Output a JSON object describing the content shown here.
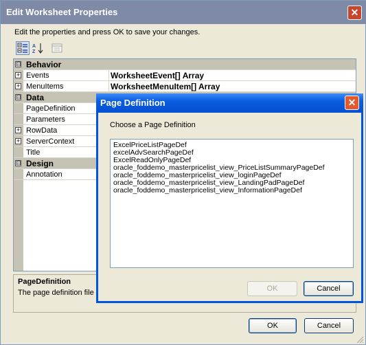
{
  "window": {
    "title": "Edit Worksheet Properties",
    "close_glyph": "✕"
  },
  "instructions": "Edit the properties and press OK to save your changes.",
  "toolbar": {
    "buttons": [
      "categorized-icon",
      "alphabetical-icon",
      "property-pages-icon"
    ]
  },
  "property_grid": {
    "rows": [
      {
        "kind": "category",
        "expander": "⊟",
        "name": "Behavior",
        "value": ""
      },
      {
        "kind": "property",
        "expander": "+",
        "name": "Events",
        "value": "WorksheetEvent[] Array"
      },
      {
        "kind": "property",
        "expander": "+",
        "name": "MenuItems",
        "value": "WorksheetMenuItem[] Array"
      },
      {
        "kind": "category",
        "expander": "⊟",
        "name": "Data",
        "value": ""
      },
      {
        "kind": "property",
        "expander": "",
        "name": "PageDefinition",
        "value": ""
      },
      {
        "kind": "property",
        "expander": "",
        "name": "Parameters",
        "value": ""
      },
      {
        "kind": "property",
        "expander": "+",
        "name": "RowData",
        "value": ""
      },
      {
        "kind": "property",
        "expander": "+",
        "name": "ServerContext",
        "value": ""
      },
      {
        "kind": "property",
        "expander": "",
        "name": "Title",
        "value": ""
      },
      {
        "kind": "category",
        "expander": "⊟",
        "name": "Design",
        "value": ""
      },
      {
        "kind": "property",
        "expander": "",
        "name": "Annotation",
        "value": ""
      }
    ]
  },
  "description": {
    "title": "PageDefinition",
    "text": "The page definition file a"
  },
  "buttons": {
    "ok": "OK",
    "cancel": "Cancel"
  },
  "modal": {
    "title": "Page Definition",
    "close_glyph": "✕",
    "prompt": "Choose a Page Definition",
    "items": [
      "ExcelPriceListPageDef",
      "excelAdvSearchPageDef",
      "ExcelReadOnlyPageDef",
      "oracle_foddemo_masterpricelist_view_PriceListSummaryPageDef",
      "oracle_foddemo_masterpricelist_view_loginPageDef",
      "oracle_foddemo_masterpricelist_view_LandingPadPageDef",
      "oracle_foddemo_masterpricelist_view_InformationPageDef"
    ],
    "ok": "OK",
    "cancel": "Cancel"
  }
}
